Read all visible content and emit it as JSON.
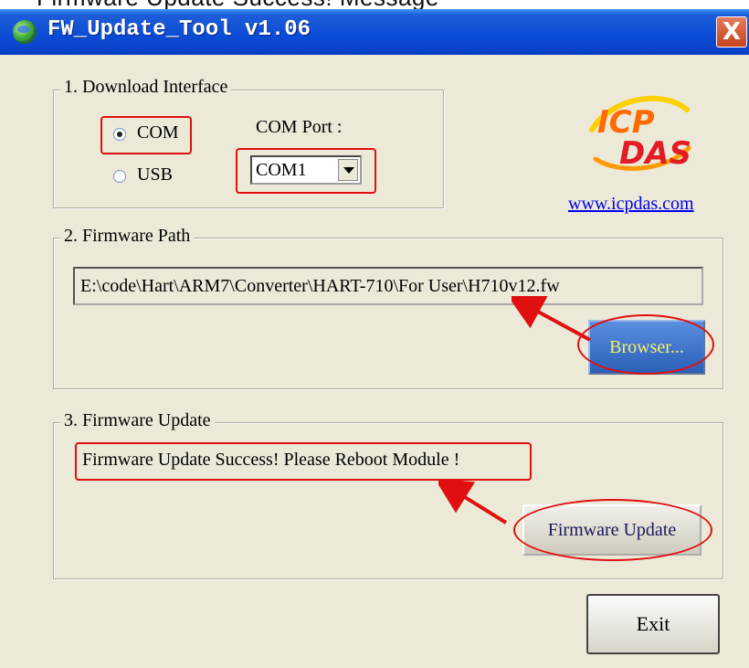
{
  "caption": "Firmware Update Success! Message",
  "window": {
    "title": "FW_Update_Tool v1.06",
    "close_glyph": "X"
  },
  "download_interface": {
    "legend": "1. Download Interface",
    "option_com": "COM",
    "option_usb": "USB",
    "selected": "COM",
    "com_port_label": "COM Port :",
    "com_port_value": "COM1"
  },
  "logo": {
    "line1": "ICP",
    "line2": "DAS",
    "link": "www.icpdas.com",
    "colors": {
      "icp": "#ff6a00",
      "das": "#e31b23",
      "swoosh": "#ffd000"
    }
  },
  "firmware_path": {
    "legend": "2. Firmware Path",
    "path_value": "E:\\code\\Hart\\ARM7\\Converter\\HART-710\\For User\\H710v12.fw",
    "browse_label": "Browser..."
  },
  "firmware_update": {
    "legend": "3. Firmware Update",
    "status": "Firmware Update Success!  Please Reboot Module !",
    "update_label": "Firmware Update"
  },
  "exit_label": "Exit",
  "colors": {
    "window_bg": "#ece9d8",
    "titlebar": "#0a4bd6",
    "highlight": "#e01010"
  }
}
